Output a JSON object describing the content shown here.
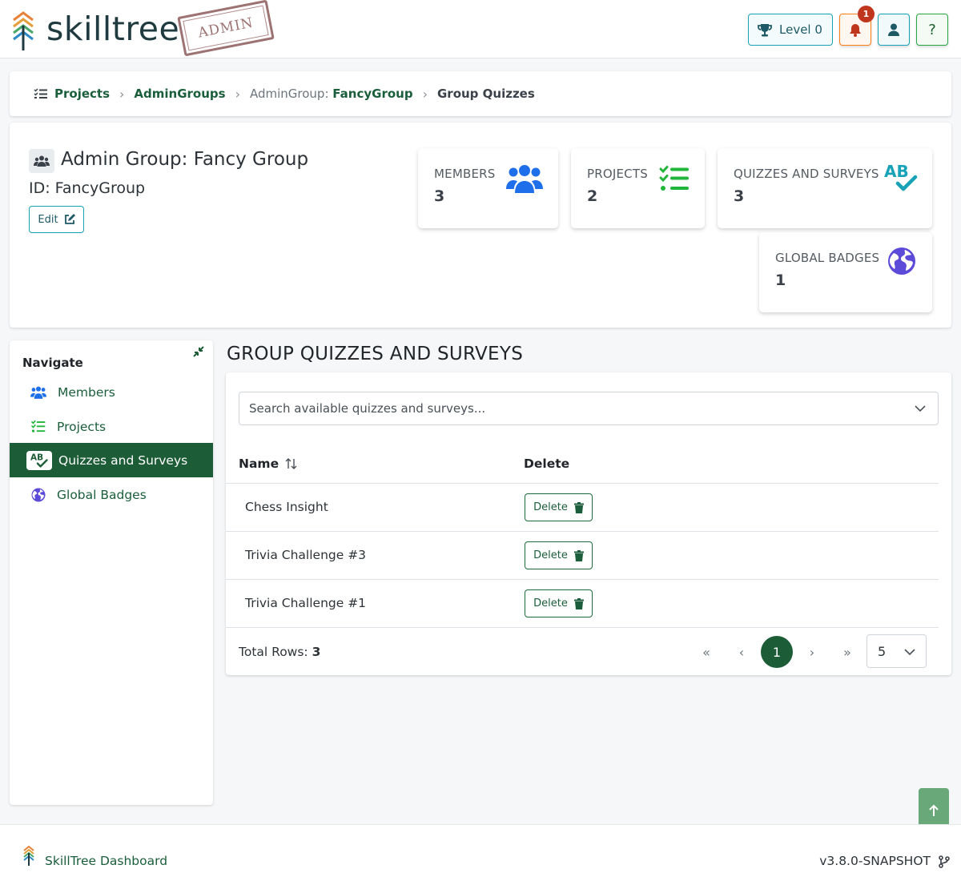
{
  "header": {
    "brand": "skilltree",
    "stamp": "ADMIN",
    "level_label": "Level 0",
    "notification_count": "1",
    "help_label": "?"
  },
  "breadcrumb": {
    "projects": "Projects",
    "admin_groups": "AdminGroups",
    "admin_group_prefix": "AdminGroup:",
    "admin_group_id": "FancyGroup",
    "current": "Group Quizzes"
  },
  "group": {
    "title": "Admin Group: Fancy Group",
    "id_line": "ID: FancyGroup",
    "edit_label": "Edit"
  },
  "stats": {
    "members": {
      "label": "MEMBERS",
      "value": "3"
    },
    "projects": {
      "label": "PROJECTS",
      "value": "2"
    },
    "quizzes": {
      "label": "QUIZZES AND SURVEYS",
      "value": "3"
    },
    "badges": {
      "label": "GLOBAL BADGES",
      "value": "1"
    }
  },
  "sidebar": {
    "title": "Navigate",
    "items": [
      {
        "label": "Members",
        "icon": "users-icon"
      },
      {
        "label": "Projects",
        "icon": "list-check-icon"
      },
      {
        "label": "Quizzes and Surveys",
        "icon": "spell-check-icon",
        "active": true
      },
      {
        "label": "Global Badges",
        "icon": "globe-icon"
      }
    ]
  },
  "main": {
    "title": "GROUP QUIZZES AND SURVEYS",
    "search_placeholder": "Search available quizzes and surveys...",
    "columns": {
      "name": "Name",
      "delete": "Delete"
    },
    "rows": [
      {
        "name": "Chess Insight",
        "action": "Delete"
      },
      {
        "name": "Trivia Challenge #3",
        "action": "Delete"
      },
      {
        "name": "Trivia Challenge #1",
        "action": "Delete"
      }
    ],
    "total_label": "Total Rows:",
    "total_value": "3",
    "pagination": {
      "first": "«",
      "prev": "‹",
      "current": "1",
      "next": "›",
      "last": "»",
      "per_page": "5"
    }
  },
  "footer": {
    "link": "SkillTree Dashboard",
    "version": "v3.8.0-SNAPSHOT"
  },
  "colors": {
    "primary_green": "#1c5c36",
    "link_green": "#1b5e3b",
    "info_teal": "#17a2b8",
    "warning_orange": "#fd7e14",
    "icon_blue": "#1f6feb",
    "icon_green": "#21b53a",
    "icon_indigo": "#5c4ad8"
  }
}
